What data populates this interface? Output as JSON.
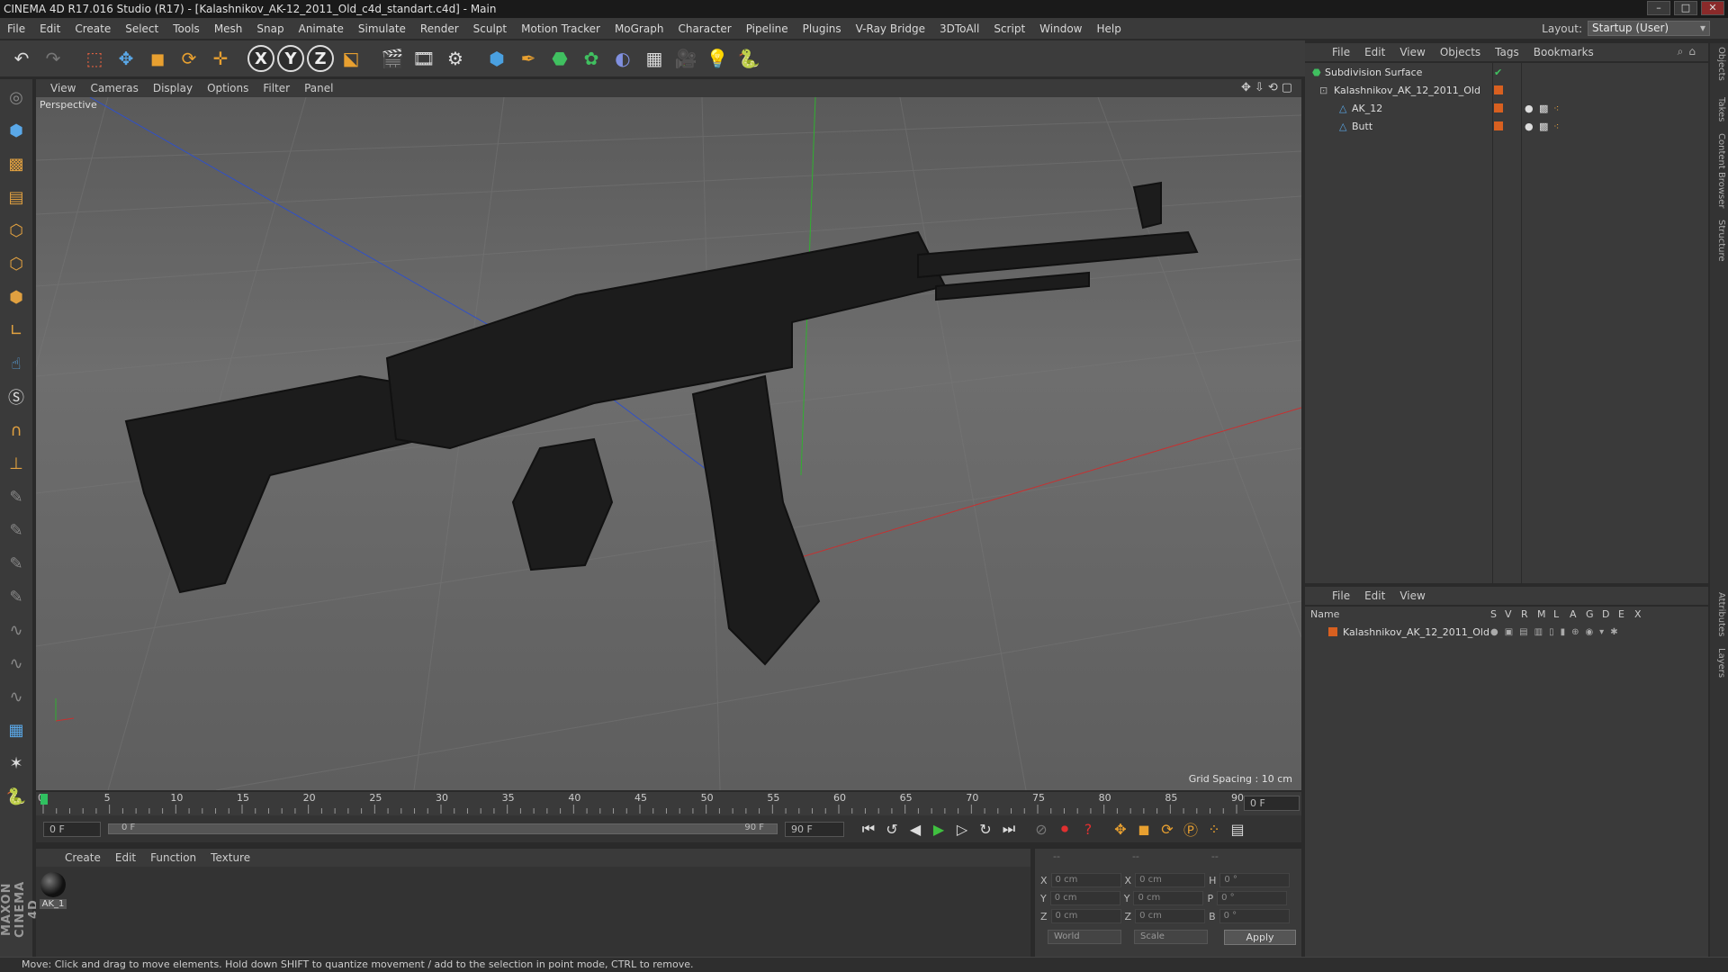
{
  "window": {
    "title": "CINEMA 4D R17.016 Studio (R17) - [Kalashnikov_AK-12_2011_Old_c4d_standart.c4d] - Main"
  },
  "menubar": [
    "File",
    "Edit",
    "Create",
    "Select",
    "Tools",
    "Mesh",
    "Snap",
    "Animate",
    "Simulate",
    "Render",
    "Sculpt",
    "Motion Tracker",
    "MoGraph",
    "Character",
    "Pipeline",
    "Plugins",
    "V-Ray Bridge",
    "3DToAll",
    "Script",
    "Window",
    "Help"
  ],
  "layout": {
    "label": "Layout:",
    "value": "Startup (User)"
  },
  "toolbar": {
    "axis_x": "X",
    "axis_y": "Y",
    "axis_z": "Z"
  },
  "viewport": {
    "menu": [
      "View",
      "Cameras",
      "Display",
      "Options",
      "Filter",
      "Panel"
    ],
    "label": "Perspective",
    "grid_spacing": "Grid Spacing : 10 cm"
  },
  "timeline": {
    "ticks": [
      "0",
      "5",
      "10",
      "15",
      "20",
      "25",
      "30",
      "35",
      "40",
      "45",
      "50",
      "55",
      "60",
      "65",
      "70",
      "75",
      "80",
      "85",
      "90"
    ],
    "current_frame": "0 F",
    "start_field": "0 F",
    "range_start": "0 F",
    "range_end": "90 F",
    "end_field": "90 F"
  },
  "material_manager": {
    "menu": [
      "Create",
      "Edit",
      "Function",
      "Texture"
    ],
    "materials": [
      {
        "name": "AK_1"
      }
    ]
  },
  "coordinates": {
    "headers": [
      "--",
      "--",
      "--"
    ],
    "rows": [
      {
        "a": "X",
        "av": "0 cm",
        "b": "X",
        "bv": "0 cm",
        "c": "H",
        "cv": "0 °"
      },
      {
        "a": "Y",
        "av": "0 cm",
        "b": "Y",
        "bv": "0 cm",
        "c": "P",
        "cv": "0 °"
      },
      {
        "a": "Z",
        "av": "0 cm",
        "b": "Z",
        "bv": "0 cm",
        "c": "B",
        "cv": "0 °"
      }
    ],
    "mode_world": "World",
    "mode_scale": "Scale",
    "apply_label": "Apply"
  },
  "object_manager": {
    "menu": [
      "File",
      "Edit",
      "View",
      "Objects",
      "Tags",
      "Bookmarks"
    ],
    "objects": [
      {
        "name": "Subdivision Surface",
        "indent": 0
      },
      {
        "name": "Kalashnikov_AK_12_2011_Old",
        "indent": 1
      },
      {
        "name": "AK_12",
        "indent": 2
      },
      {
        "name": "Butt",
        "indent": 2
      }
    ]
  },
  "layer_manager": {
    "menu": [
      "File",
      "Edit",
      "View"
    ],
    "column_name": "Name",
    "columns": [
      "S",
      "V",
      "R",
      "M",
      "L",
      "A",
      "G",
      "D",
      "E",
      "X"
    ],
    "layers": [
      {
        "name": "Kalashnikov_AK_12_2011_Old"
      }
    ]
  },
  "side_tabs": [
    "Objects",
    "Takes",
    "Content Browser",
    "Structure",
    "Attributes",
    "Layers"
  ],
  "status": "Move: Click and drag to move elements. Hold down SHIFT to quantize movement / add to the selection in point mode, CTRL to remove.",
  "brand": "MAXON CINEMA 4D",
  "colors": {
    "accent_orange": "#d86020",
    "axis_red": "#c83030",
    "axis_green": "#30b030",
    "axis_blue": "#3050c8"
  }
}
